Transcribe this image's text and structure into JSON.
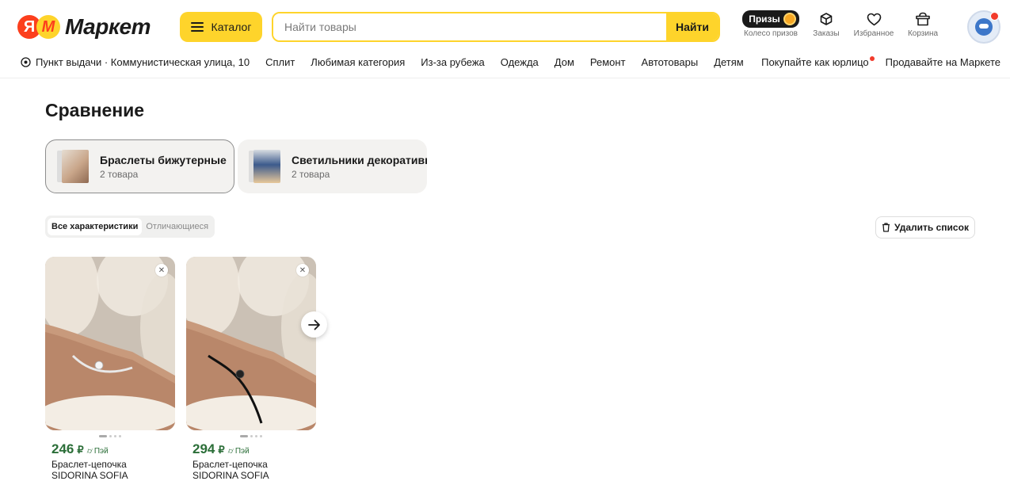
{
  "header": {
    "logo_ya": "Я",
    "logo_m": "М",
    "logo_word": "Маркет",
    "catalog_label": "Каталог",
    "search_placeholder": "Найти товары",
    "search_button": "Найти",
    "prizes_badge": "Призы",
    "prizes_label": "Колесо призов",
    "orders_label": "Заказы",
    "favorites_label": "Избранное",
    "cart_label": "Корзина"
  },
  "nav": {
    "pickup": "Пункт выдачи · Коммунистическая улица, 10",
    "links": [
      "Сплит",
      "Любимая категория",
      "Из-за рубежа",
      "Одежда",
      "Дом",
      "Ремонт",
      "Автотовары",
      "Детям"
    ],
    "business": "Покупайте как юрлицо",
    "sell": "Продавайте на Маркете"
  },
  "page": {
    "title": "Сравнение",
    "categories": [
      {
        "name": "Браслеты бижутерные",
        "count": "2 товара",
        "active": true
      },
      {
        "name": "Светильники декоративные",
        "count": "2 товара",
        "active": false
      }
    ],
    "filter_all": "Все характеристики",
    "filter_diff": "Отличающиеся",
    "delete_list": "Удалить список",
    "products": [
      {
        "price": "246",
        "currency": "₽",
        "pay": "Пэй",
        "name_line1": "Браслет-цепочка",
        "name_line2": "SIDORINA SOFIA",
        "cord_color": "#e9e9e9"
      },
      {
        "price": "294",
        "currency": "₽",
        "pay": "Пэй",
        "name_line1": "Браслет-цепочка",
        "name_line2": "SIDORINA SOFIA",
        "cord_color": "#111111"
      }
    ]
  },
  "colors": {
    "accent": "#fed42b",
    "price_green": "#2b6e38",
    "brand_red": "#fc3f1d"
  }
}
